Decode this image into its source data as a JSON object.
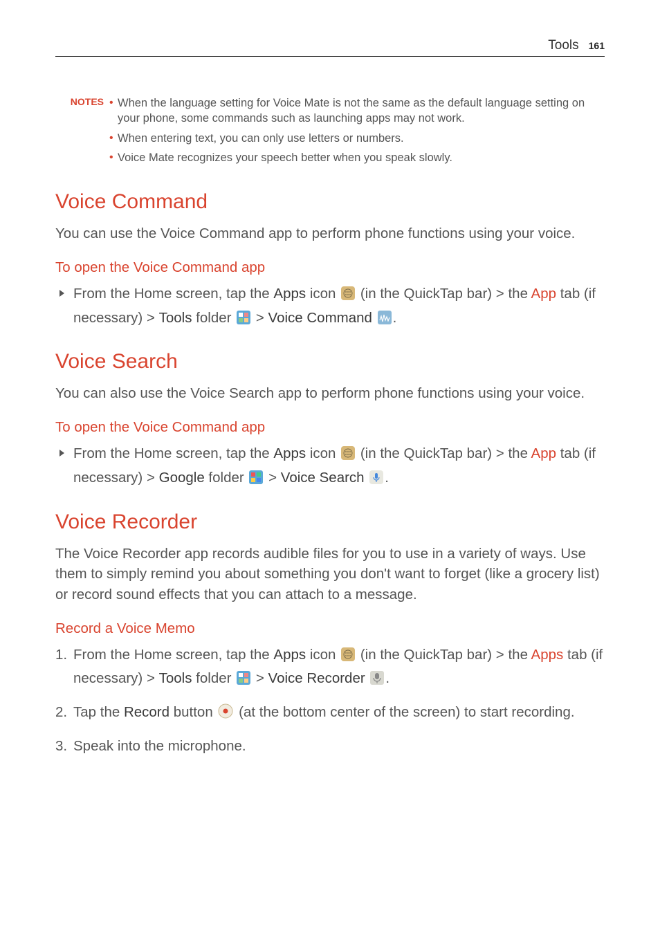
{
  "header": {
    "chapter": "Tools",
    "page": "161"
  },
  "notes": {
    "label": "NOTES",
    "items": [
      "When the language setting for Voice Mate is not the same as the default language setting on your phone, some commands such as launching apps may not work.",
      "When entering text, you can only use letters or numbers.",
      "Voice Mate recognizes your speech better when you speak slowly."
    ]
  },
  "sections": {
    "voice_command": {
      "title": "Voice Command",
      "intro": "You can use the Voice Command app to perform phone functions using your voice.",
      "sub_title": "To open the Voice Command app",
      "step": {
        "pre": "From the Home screen, tap the ",
        "apps": "Apps",
        "post_apps": " icon ",
        "post_icon1": " (in the QuickTap bar) > the ",
        "app_tab": "App",
        "post_apptab": " tab (if necessary) > ",
        "tools": "Tools",
        "post_tools": " folder ",
        "gt1": " > ",
        "vc": "Voice Command",
        "end": "."
      }
    },
    "voice_search": {
      "title": "Voice Search",
      "intro": "You can also use the Voice Search app to perform phone functions using your voice.",
      "sub_title": "To open the Voice Command app",
      "step": {
        "pre": "From the Home screen, tap the ",
        "apps": "Apps",
        "post_apps": " icon ",
        "post_icon1": " (in the QuickTap bar) > the ",
        "app_tab": "App",
        "post_apptab": " tab (if necessary) > ",
        "google": "Google",
        "post_google": " folder ",
        "gt1": " > ",
        "vs": "Voice Search",
        "end": "."
      }
    },
    "voice_recorder": {
      "title": "Voice Recorder",
      "intro": "The Voice Recorder app records audible files for you to use in a variety of ways. Use them to simply remind you about something you don't want to forget (like a grocery list) or record sound effects that you can attach to a message.",
      "sub_title": "Record a Voice Memo",
      "steps": {
        "s1": {
          "n": "1.",
          "pre": "From the Home screen, tap the ",
          "apps": "Apps",
          "post_apps": " icon ",
          "post_icon1": " (in the QuickTap bar) > the ",
          "apps_tab": "Apps",
          "post_appstab": " tab (if necessary) > ",
          "tools": "Tools",
          "post_tools": " folder ",
          "gt1": " > ",
          "vr": "Voice Recorder",
          "end": "."
        },
        "s2": {
          "n": "2.",
          "pre": "Tap the ",
          "record": "Record",
          "post_record": " button ",
          "post_icon": " (at the bottom center of the screen) to start recording."
        },
        "s3": {
          "n": "3.",
          "text": "Speak into the microphone."
        }
      }
    }
  }
}
